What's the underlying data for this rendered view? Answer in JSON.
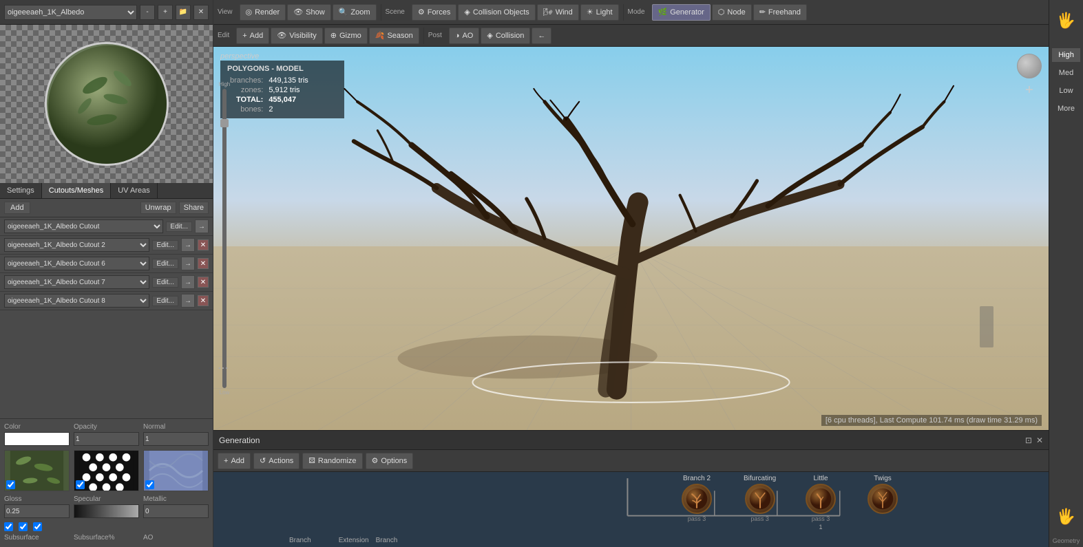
{
  "left_panel": {
    "texture_select": "oigeeeaeh_1K_Albedo",
    "tabs": [
      "Settings",
      "Cutouts/Meshes",
      "UV Areas"
    ],
    "active_tab": "Cutouts/Meshes",
    "add_label": "Add",
    "unwrap_label": "Unwrap",
    "share_label": "Share",
    "mesh_items": [
      {
        "name": "oigeeeaeh_1K_Albedo Cutout",
        "edit": "Edit..."
      },
      {
        "name": "oigeeeaeh_1K_Albedo Cutout 2",
        "edit": "Edit..."
      },
      {
        "name": "oigeeeaeh_1K_Albedo Cutout 6",
        "edit": "Edit..."
      },
      {
        "name": "oigeeeaeh_1K_Albedo Cutout 7",
        "edit": "Edit..."
      },
      {
        "name": "oigeeeaeh_1K_Albedo Cutout 8",
        "edit": "Edit..."
      }
    ],
    "color_label": "Color",
    "opacity_label": "Opacity",
    "opacity_val": "1",
    "normal_label": "Normal",
    "normal_val": "1",
    "gloss_label": "Gloss",
    "gloss_val": "0.25",
    "specular_label": "Specular",
    "metallic_label": "Metallic",
    "metallic_val": "0",
    "subsurface_label": "Subsurface",
    "subsurface_pct_label": "Subsurface%",
    "ao_label": "AO"
  },
  "toolbar": {
    "view_label": "View",
    "scene_label": "Scene",
    "mode_label": "Mode",
    "render_label": "Render",
    "show_label": "Show",
    "zoom_label": "Zoom",
    "forces_label": "Forces",
    "collision_label": "Collision Objects",
    "wind_label": "Wind",
    "light_label": "Light",
    "generator_label": "Generator",
    "node_label": "Node",
    "freehand_label": "Freehand"
  },
  "edit_row": {
    "edit_label": "Edit",
    "post_label": "Post",
    "add_label": "Add",
    "visibility_label": "Visibility",
    "gizmo_label": "Gizmo",
    "season_label": "Season",
    "ao_label": "AO",
    "collision_label": "Collision"
  },
  "viewport": {
    "label": "perspective",
    "poly_info": {
      "title": "POLYGONS - MODEL",
      "branches_label": "branches:",
      "branches_val": "449,135 tris",
      "zones_label": "zones:",
      "zones_val": "5,912 tris",
      "total_label": "TOTAL:",
      "total_val": "455,047",
      "bones_label": "bones:",
      "bones_val": "2"
    },
    "status": "[6 cpu threads], Last Compute 101.74 ms (draw time 31.29 ms)",
    "slider_high": "High",
    "slider_low": "Low"
  },
  "right_panel": {
    "quality_levels": [
      "High",
      "Med",
      "Low",
      "More"
    ]
  },
  "generation": {
    "title": "Generation",
    "add_label": "Add",
    "actions_label": "Actions",
    "randomize_label": "Randomize",
    "options_label": "Options",
    "nodes": [
      {
        "label": "Branch 2",
        "sub": "pass 3",
        "icon": "🌿"
      },
      {
        "label": "Bifurcating",
        "sub": "pass 3",
        "icon": "🌿"
      },
      {
        "label": "Little",
        "sub": "pass 3",
        "icon": "🌿"
      },
      {
        "label": "Twigs",
        "sub": "",
        "icon": "🌿"
      }
    ],
    "bottom_labels": [
      "Branch",
      "Extension"
    ],
    "branch_label": "Branch"
  }
}
